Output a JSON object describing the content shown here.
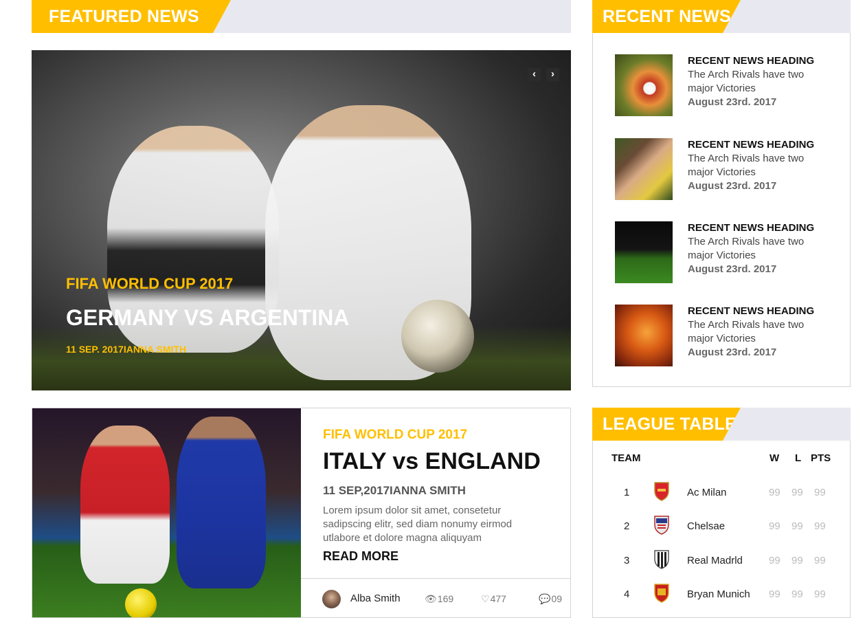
{
  "featured_section": {
    "heading": "FEATURED NEWS"
  },
  "recent_section": {
    "heading": "RECENT NEWS"
  },
  "league_section": {
    "heading": "LEAGUE TABLE"
  },
  "featured_slide": {
    "category": "FIFA WORLD CUP 2017",
    "title": "GERMANY VS ARGENTINA",
    "meta": "11 SEP. 2017IANNA SMITH",
    "prev_icon": "chevron-left-icon",
    "next_icon": "chevron-right-icon",
    "prev_glyph": "‹",
    "next_glyph": "›"
  },
  "article": {
    "category": "FIFA WORLD CUP 2017",
    "title": "ITALY vs ENGLAND",
    "meta": "11 SEP,2017IANNA SMITH",
    "excerpt": "Lorem ipsum dolor sit amet, consetetur sadipscing elitr, sed diam nonumy eirmod utlabore et dolore magna aliquyam",
    "read_more": "READ MORE",
    "author": "Alba Smith",
    "views": "169",
    "likes": "477",
    "comments": "09",
    "view_glyph": "👁",
    "like_glyph": "♡",
    "comment_glyph": "💬"
  },
  "recent_news": [
    {
      "heading": "RECENT NEWS HEADING",
      "desc": "The Arch Rivals have two major Victories",
      "date": "August 23rd. 2017"
    },
    {
      "heading": "RECENT NEWS HEADING",
      "desc": "The Arch Rivals have two major Victories",
      "date": "August 23rd. 2017"
    },
    {
      "heading": "RECENT NEWS HEADING",
      "desc": "The Arch Rivals have two major Victories",
      "date": "August 23rd. 2017"
    },
    {
      "heading": "RECENT NEWS HEADING",
      "desc": "The Arch Rivals have two major Victories",
      "date": "August 23rd. 2017"
    }
  ],
  "league_table": {
    "headers": {
      "team": "TEAM",
      "w": "W",
      "l": "L",
      "pts": "PTS"
    },
    "rows": [
      {
        "rank": "1",
        "team": "Ac Milan",
        "w": "99",
        "l": "99",
        "pts": "99"
      },
      {
        "rank": "2",
        "team": "Chelsae",
        "w": "99",
        "l": "99",
        "pts": "99"
      },
      {
        "rank": "3",
        "team": "Real Madrld",
        "w": "99",
        "l": "99",
        "pts": "99"
      },
      {
        "rank": "4",
        "team": "Bryan Munich",
        "w": "99",
        "l": "99",
        "pts": "99"
      }
    ]
  },
  "colors": {
    "accent": "#ffbf00",
    "header_bg": "#e8e9f0",
    "border": "#d4d4d4"
  }
}
